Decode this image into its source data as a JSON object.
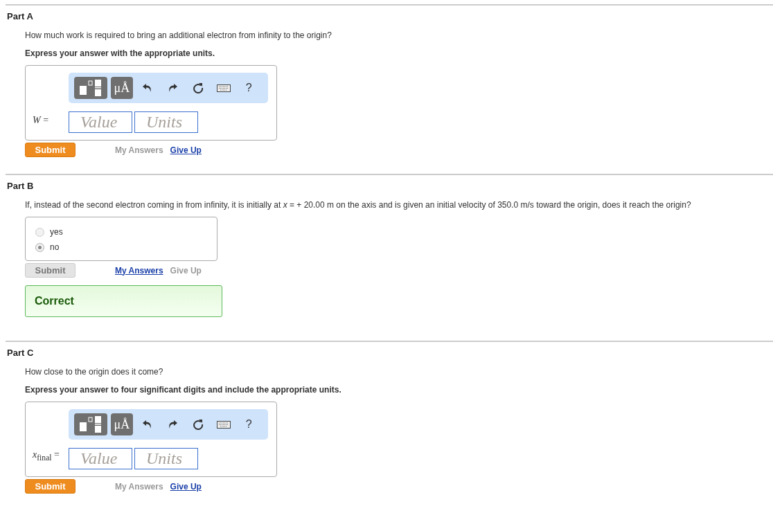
{
  "parts": [
    {
      "title": "Part A",
      "kind": "units",
      "question": "How much work is required to bring an additional electron from infinity to the origin?",
      "instruction": "Express your answer with the appropriate units.",
      "toolbar": [
        {
          "kind": "templates"
        },
        {
          "kind": "units",
          "label": "μÅ"
        },
        {
          "kind": "undo"
        },
        {
          "kind": "redo"
        },
        {
          "kind": "reset"
        },
        {
          "kind": "keyboard"
        },
        {
          "kind": "help",
          "label": "?"
        }
      ],
      "label": "*W* =",
      "value_placeholder": "Value",
      "units_placeholder": "Units",
      "submit": {
        "label": "Submit",
        "disabled": false
      },
      "my_answers": {
        "label": "My Answers",
        "enabled": false
      },
      "give_up": {
        "label": "Give Up",
        "enabled": true
      }
    },
    {
      "title": "Part B",
      "kind": "choice",
      "question": "If, instead of the second electron coming in from infinity, it is initially at *x* = + 20.00 m on the axis and is given an initial velocity of 350.0  m/s toward the origin, does it reach the origin?",
      "options": [
        {
          "label": "yes",
          "selected": false
        },
        {
          "label": "no",
          "selected": true
        }
      ],
      "submit": {
        "label": "Submit",
        "disabled": true
      },
      "my_answers": {
        "label": "My Answers",
        "enabled": true
      },
      "give_up": {
        "label": "Give Up",
        "enabled": false
      },
      "feedback": {
        "text": "Correct"
      }
    },
    {
      "title": "Part C",
      "kind": "units",
      "question": "How close to the origin does it come?",
      "instruction": "Express your answer to four significant digits and include the appropriate units.",
      "toolbar": [
        {
          "kind": "templates"
        },
        {
          "kind": "units",
          "label": "μÅ"
        },
        {
          "kind": "undo"
        },
        {
          "kind": "redo"
        },
        {
          "kind": "reset"
        },
        {
          "kind": "keyboard"
        },
        {
          "kind": "help",
          "label": "?"
        }
      ],
      "label": "*x*$_{final}$ =",
      "value_placeholder": "Value",
      "units_placeholder": "Units",
      "submit": {
        "label": "Submit",
        "disabled": false
      },
      "my_answers": {
        "label": "My Answers",
        "enabled": false
      },
      "give_up": {
        "label": "Give Up",
        "enabled": true
      }
    }
  ]
}
